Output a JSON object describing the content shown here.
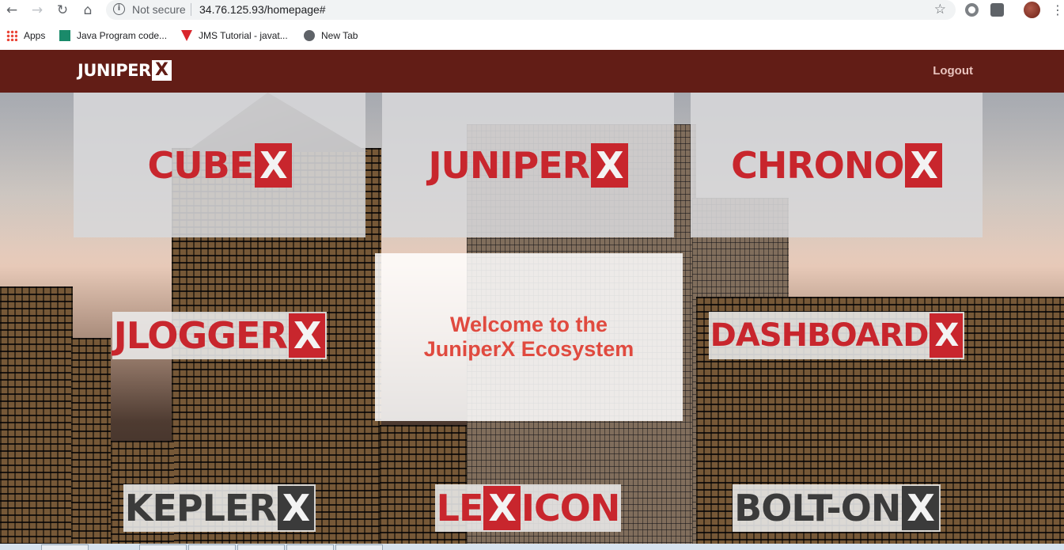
{
  "browser": {
    "security_label": "Not secure",
    "url": "34.76.125.93/homepage#",
    "bookmarks": [
      {
        "label": "Apps",
        "icon": "apps-grid-icon"
      },
      {
        "label": "Java Program code...",
        "icon": "site-favicon"
      },
      {
        "label": "JMS Tutorial - javat...",
        "icon": "javatpoint-favicon"
      },
      {
        "label": "New Tab",
        "icon": "globe-icon"
      }
    ]
  },
  "header": {
    "brand_text": "JUNIPER",
    "brand_x": "X",
    "logout_label": "Logout",
    "bg_color": "#621d16"
  },
  "tiles": [
    {
      "name": "cubex",
      "word": "CUBE",
      "x": "X",
      "style": "red"
    },
    {
      "name": "juniperx",
      "word": "JUNIPER",
      "x": "X",
      "style": "red"
    },
    {
      "name": "chronox",
      "word": "CHRONO",
      "x": "X",
      "style": "red"
    },
    {
      "name": "jloggerx",
      "word": "JLOGGER",
      "x": "X",
      "style": "red"
    },
    {
      "name": "dashboardx",
      "word": "DASHBOARD",
      "x": "X",
      "style": "red"
    },
    {
      "name": "keplerx",
      "word": "KEPLER",
      "x": "X",
      "style": "dark"
    },
    {
      "name": "lexicon",
      "word_a": "LE",
      "x": "X",
      "word_b": "ICON",
      "style": "red"
    },
    {
      "name": "bolt-onx",
      "word": "BOLT-ON",
      "x": "X",
      "style": "dark"
    }
  ],
  "welcome": {
    "line1": "Welcome to the",
    "line2": "JuniperX Ecosystem",
    "color": "#e04a3f"
  }
}
